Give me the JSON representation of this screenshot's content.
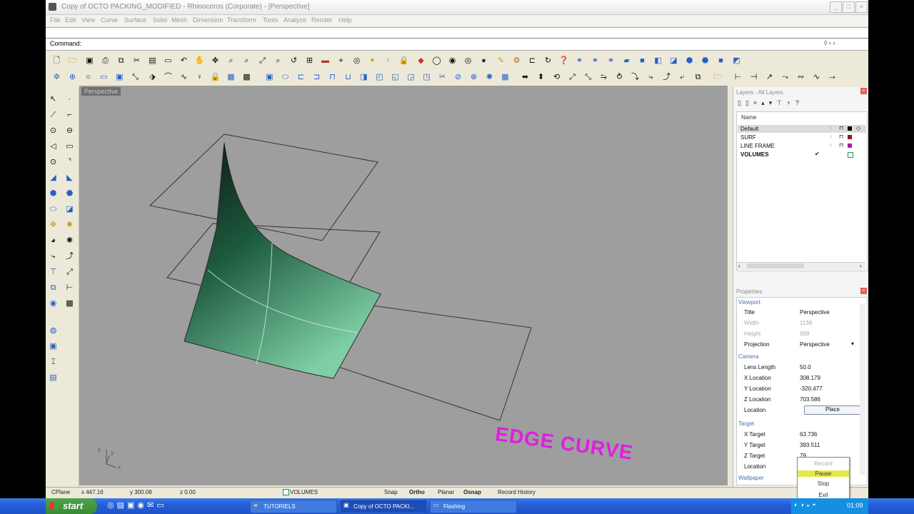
{
  "window": {
    "title": "Copy of OCTO PACKING_MODIFIED - Rhinoceros (Corporate) - [Perspective]",
    "buttons": [
      "_",
      "□",
      "×"
    ]
  },
  "menu": [
    "File",
    "Edit",
    "View",
    "Curve",
    "Surface",
    "Solid",
    "Mesh",
    "Dimension",
    "Transform",
    "Tools",
    "Analyze",
    "Render",
    "Help"
  ],
  "command": {
    "label": "Command:"
  },
  "viewport": {
    "label": "Perspective",
    "annotation": "EDGE CURVE",
    "annotation_color": "#e01ee0",
    "axis_x": "x",
    "axis_y": "y",
    "axis_z": "z"
  },
  "layers": {
    "header": "Layers - All Layers",
    "name_col": "Name",
    "items": [
      {
        "name": "Default",
        "color": "#000000",
        "current": false
      },
      {
        "name": "SURF",
        "color": "#8b1a1a",
        "current": false
      },
      {
        "name": "LINE FRAME",
        "color": "#a020a0",
        "current": false
      },
      {
        "name": "VOLUMES",
        "color": "#ffffff",
        "current": true
      }
    ]
  },
  "properties": {
    "header": "Properties",
    "viewport_section": "Viewport",
    "title_k": "Title",
    "title_v": "Perspective",
    "width_k": "Width",
    "width_v": "1138",
    "height_k": "Height",
    "height_v": "699",
    "projection_k": "Projection",
    "projection_v": "Perspective",
    "camera_section": "Camera",
    "lens_k": "Lens Length",
    "lens_v": "50.0",
    "xloc_k": "X Location",
    "xloc_v": "308.179",
    "yloc_k": "Y Location",
    "yloc_v": "-320.477",
    "zloc_k": "Z Location",
    "zloc_v": "703.586",
    "loc_k": "Location",
    "place_btn": "Place",
    "target_section": "Target",
    "xt_k": "X Target",
    "xt_v": "63.736",
    "yt_k": "Y Target",
    "yt_v": "393.511",
    "zt_k": "Z Target",
    "zt_v": "79",
    "tloc_k": "Location",
    "wallpaper": "Wallpaper"
  },
  "popup": [
    "Record",
    "Pause",
    "Stop",
    "Exit"
  ],
  "status": {
    "cplane": "CPlane",
    "x": "x 447.16",
    "y": "y 300.08",
    "z": "z 0.00",
    "layer": "VOLUMES",
    "snap": "Snap",
    "ortho": "Ortho",
    "planar": "Planar",
    "osnap": "Osnap",
    "history": "Record History"
  },
  "taskbar": {
    "start": "start",
    "tasks": [
      "TUTORIELS",
      "Copy of OCTO PACKI...",
      "Flashing"
    ],
    "clock": "01:09"
  }
}
